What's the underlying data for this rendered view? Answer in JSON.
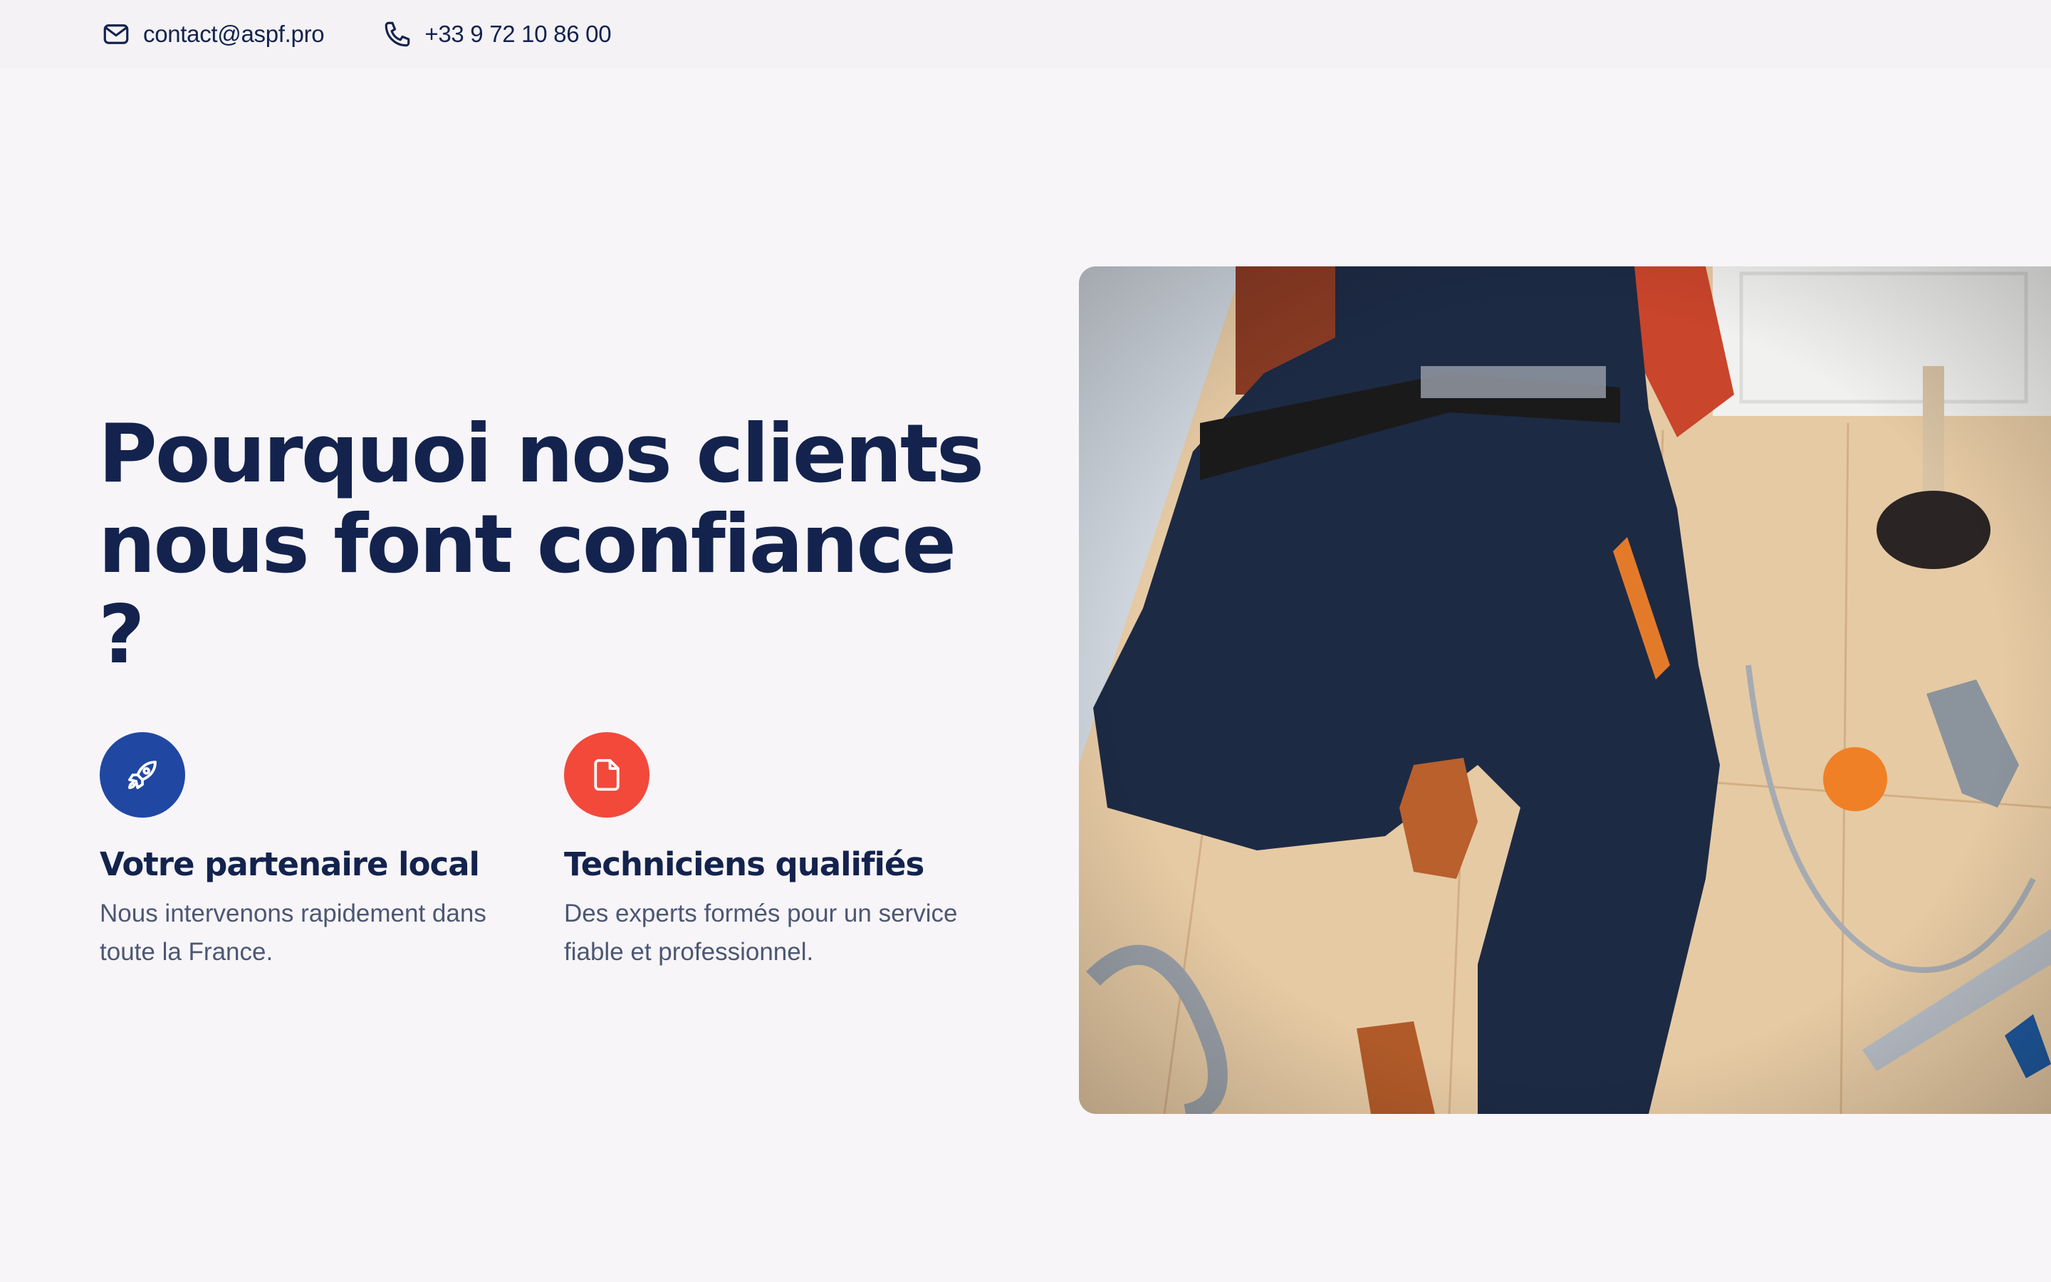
{
  "topbar": {
    "email": "contact@aspf.pro",
    "email_icon": "mail-icon",
    "phone": "+33 9 72 10 86 00",
    "phone_icon": "phone-icon"
  },
  "hero": {
    "title_line1": "Pourquoi nos clients",
    "title_line2": "nous font confiance ?"
  },
  "features": [
    {
      "icon": "rocket-icon",
      "icon_color": "#2048a3",
      "title": "Votre partenaire local",
      "text": "Nous intervenons rapidement dans toute la France."
    },
    {
      "icon": "document-icon",
      "icon_color": "#f2493b",
      "title": "Techniciens qualifiés",
      "text": "Des experts formés pour un service fiable et professionnel."
    }
  ],
  "photo": {
    "subject": "plumber-lying-on-floor-with-tools"
  },
  "colors": {
    "background": "#f7f5f8",
    "heading": "#13234d",
    "body_text": "#4c5773",
    "accent_blue": "#2048a3",
    "accent_red": "#f2493b"
  }
}
